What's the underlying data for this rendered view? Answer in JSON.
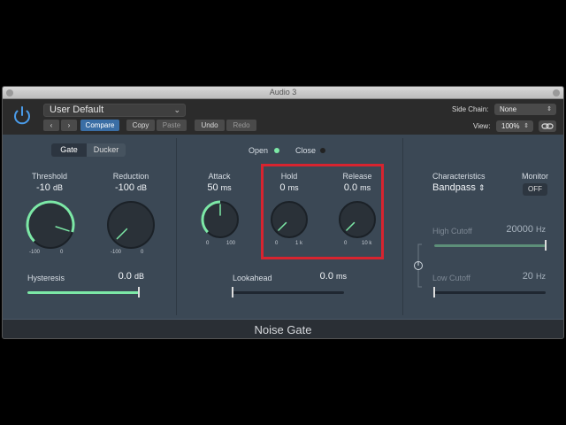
{
  "window": {
    "title": "Audio 3"
  },
  "header": {
    "preset": "User Default",
    "nav_prev": "‹",
    "nav_next": "›",
    "compare": "Compare",
    "copy": "Copy",
    "paste": "Paste",
    "undo": "Undo",
    "redo": "Redo",
    "side_chain_label": "Side Chain:",
    "side_chain_value": "None",
    "view_label": "View:",
    "view_value": "100%"
  },
  "mode": {
    "gate": "Gate",
    "ducker": "Ducker",
    "selected": "Gate"
  },
  "threshold": {
    "label": "Threshold",
    "value": "-10",
    "unit": "dB",
    "min": "-100",
    "max": "0",
    "level": 0.9
  },
  "reduction": {
    "label": "Reduction",
    "value": "-100",
    "unit": "dB",
    "min": "-100",
    "max": "0",
    "level": 0.0
  },
  "hysteresis": {
    "label": "Hysteresis",
    "value": "0.0",
    "unit": "dB",
    "level": 1.0
  },
  "indicators": {
    "open": "Open",
    "close": "Close",
    "colors": {
      "open": "#7ce8a6",
      "close": "#222222"
    }
  },
  "attack": {
    "label": "Attack",
    "value": "50",
    "unit": "ms",
    "min": "0",
    "max": "100",
    "level": 0.5
  },
  "hold": {
    "label": "Hold",
    "value": "0",
    "unit": "ms",
    "min": "0",
    "max": "1 k",
    "level": 0.0
  },
  "release": {
    "label": "Release",
    "value": "0.0",
    "unit": "ms",
    "min": "0",
    "max": "10 k",
    "level": 0.0
  },
  "lookahead": {
    "label": "Lookahead",
    "value": "0.0",
    "unit": "ms",
    "level": 0.0
  },
  "characteristics": {
    "label": "Characteristics",
    "value": "Bandpass"
  },
  "monitor": {
    "label": "Monitor",
    "value": "OFF"
  },
  "high_cutoff": {
    "label": "High Cutoff",
    "value": "20000",
    "unit": "Hz",
    "level": 1.0
  },
  "low_cutoff": {
    "label": "Low Cutoff",
    "value": "20",
    "unit": "Hz",
    "level": 0.0
  },
  "footer": {
    "title": "Noise Gate"
  },
  "colors": {
    "accent": "#7ce8a6",
    "highlight_box": "#d8242f",
    "power": "#4a9be8"
  }
}
